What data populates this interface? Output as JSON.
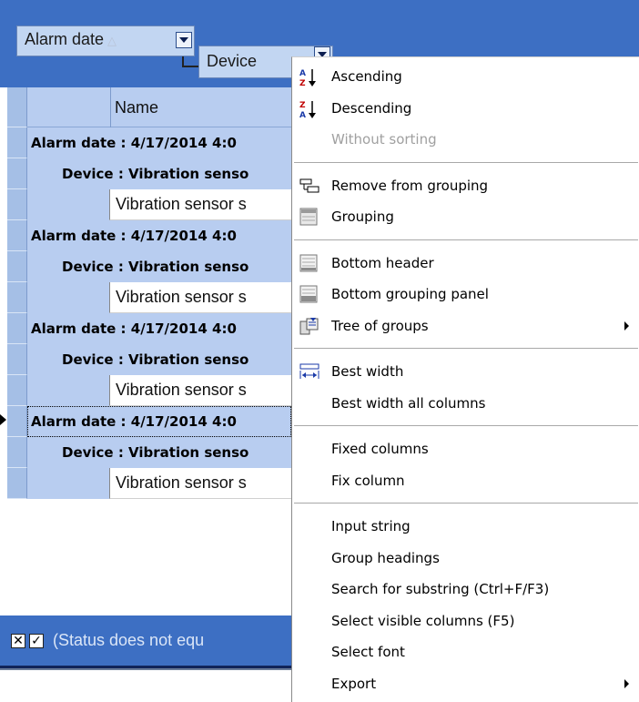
{
  "group_panel": {
    "chips": [
      {
        "label": "Alarm date",
        "sort_indicator": "△"
      },
      {
        "label": "Device"
      }
    ]
  },
  "grid": {
    "header_name": "Name",
    "rows": [
      {
        "type": "group1",
        "text": "Alarm date : 4/17/2014 4:0"
      },
      {
        "type": "group2",
        "text": "Device : Vibration senso"
      },
      {
        "type": "data",
        "text": "Vibration sensor s"
      },
      {
        "type": "group1",
        "text": "Alarm date : 4/17/2014 4:0"
      },
      {
        "type": "group2",
        "text": "Device : Vibration senso"
      },
      {
        "type": "data",
        "text": "Vibration sensor s"
      },
      {
        "type": "group1",
        "text": "Alarm date : 4/17/2014 4:0"
      },
      {
        "type": "group2",
        "text": "Device : Vibration senso"
      },
      {
        "type": "data",
        "text": "Vibration sensor s"
      },
      {
        "type": "group1",
        "text": "Alarm date : 4/17/2014 4:0",
        "focused": true
      },
      {
        "type": "group2",
        "text": "Device : Vibration senso"
      },
      {
        "type": "data",
        "text": "Vibration sensor s"
      }
    ]
  },
  "filter_bar": {
    "close_symbol": "✕",
    "check_symbol": "✓",
    "text": "(Status does not equ"
  },
  "context_menu": {
    "items": [
      {
        "label": "Ascending",
        "icon": "sort-ascending-icon",
        "disabled": false
      },
      {
        "label": "Descending",
        "icon": "sort-descending-icon",
        "disabled": false
      },
      {
        "label": "Without sorting",
        "icon": "",
        "disabled": true
      },
      {
        "separator": true
      },
      {
        "label": "Remove from grouping",
        "icon": "remove-grouping-icon",
        "disabled": false
      },
      {
        "label": "Grouping",
        "icon": "grouping-panel-icon",
        "disabled": false
      },
      {
        "separator": true
      },
      {
        "label": "Bottom header",
        "icon": "bottom-header-icon",
        "disabled": false
      },
      {
        "label": "Bottom grouping panel",
        "icon": "bottom-grouping-panel-icon",
        "disabled": false
      },
      {
        "label": "Tree of groups",
        "icon": "tree-of-groups-icon",
        "disabled": false,
        "submenu": true
      },
      {
        "separator": true
      },
      {
        "label": "Best width",
        "icon": "best-width-icon",
        "disabled": false
      },
      {
        "label": "Best width all columns",
        "icon": "",
        "disabled": false
      },
      {
        "separator": true
      },
      {
        "label": "Fixed columns",
        "icon": "",
        "disabled": false
      },
      {
        "label": "Fix column",
        "icon": "",
        "disabled": false
      },
      {
        "separator": true
      },
      {
        "label": "Input string",
        "icon": "",
        "disabled": false
      },
      {
        "label": "Group headings",
        "icon": "",
        "disabled": false
      },
      {
        "label": "Search for substring (Ctrl+F/F3)",
        "icon": "",
        "disabled": false
      },
      {
        "label": "Select visible columns (F5)",
        "icon": "",
        "disabled": false
      },
      {
        "label": "Select font",
        "icon": "",
        "disabled": false
      },
      {
        "label": "Export",
        "icon": "",
        "disabled": false,
        "submenu": true
      }
    ]
  }
}
